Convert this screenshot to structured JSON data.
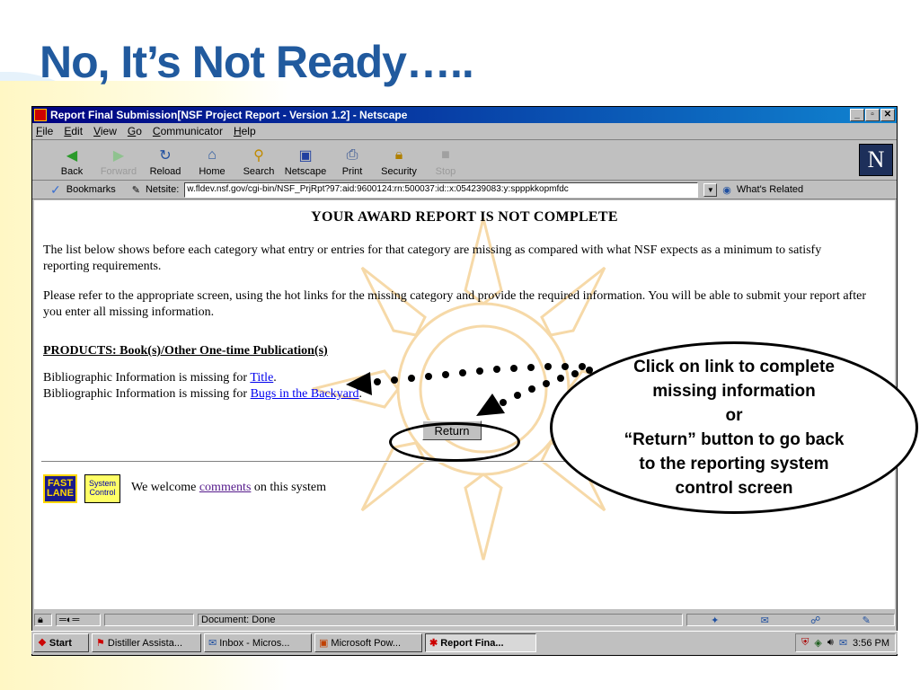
{
  "slide": {
    "title": "No, It’s Not Ready….."
  },
  "window": {
    "title": "Report Final Submission[NSF Project Report - Version 1.2] - Netscape",
    "buttons": [
      "_",
      "▫",
      "✕"
    ]
  },
  "menu": [
    "File",
    "Edit",
    "View",
    "Go",
    "Communicator",
    "Help"
  ],
  "toolbar": [
    {
      "label": "Back",
      "icon": "back-arrow-icon",
      "enabled": true
    },
    {
      "label": "Forward",
      "icon": "forward-arrow-icon",
      "enabled": false
    },
    {
      "label": "Reload",
      "icon": "reload-icon",
      "enabled": true
    },
    {
      "label": "Home",
      "icon": "home-icon",
      "enabled": true
    },
    {
      "label": "Search",
      "icon": "search-icon",
      "enabled": true
    },
    {
      "label": "Netscape",
      "icon": "my-netscape-icon",
      "enabled": true
    },
    {
      "label": "Print",
      "icon": "print-icon",
      "enabled": true
    },
    {
      "label": "Security",
      "icon": "lock-icon",
      "enabled": true
    },
    {
      "label": "Stop",
      "icon": "stop-icon",
      "enabled": false
    }
  ],
  "location": {
    "bookmarks": "Bookmarks",
    "netsite_label": "Netsite:",
    "url": "w.fldev.nsf.gov/cgi-bin/NSF_PrjRpt?97:aid:9600124:rn:500037:id::x:054239083:y:spppkkopmfdc",
    "whats_related": "What's Related"
  },
  "page": {
    "heading": "YOUR AWARD REPORT IS NOT COMPLETE",
    "para1": "The list below shows before each category what entry or entries for that category are missing as compared with what NSF expects as a minimum to satisfy reporting requirements.",
    "para2": "Please refer to the appropriate screen, using the hot links for the missing category and provide the required information. You will be able to submit your report after you enter all missing information.",
    "section": "PRODUCTS: Book(s)/Other One-time Publication(s)",
    "missing_prefix": "Bibliographic Information is missing for",
    "missing_links": [
      "Title",
      "Bugs in the Backyard"
    ],
    "return_label": "Return",
    "welcome_prefix": "We welcome",
    "comments_link": "comments",
    "welcome_suffix": "on this system",
    "fast_lane": "FAST LANE",
    "system_control": "System Control"
  },
  "status": {
    "text": "Document: Done"
  },
  "taskbar": {
    "start": "Start",
    "items": [
      {
        "label": "Distiller Assista...",
        "active": false
      },
      {
        "label": "Inbox - Micros...",
        "active": false
      },
      {
        "label": "Microsoft Pow...",
        "active": false
      },
      {
        "label": "Report Fina...",
        "active": true
      }
    ],
    "clock": "3:56 PM"
  },
  "callout": {
    "lines": [
      "Click on link to complete",
      "missing information",
      "or",
      "“Return” button to go back",
      "to the reporting system",
      "control screen"
    ]
  }
}
